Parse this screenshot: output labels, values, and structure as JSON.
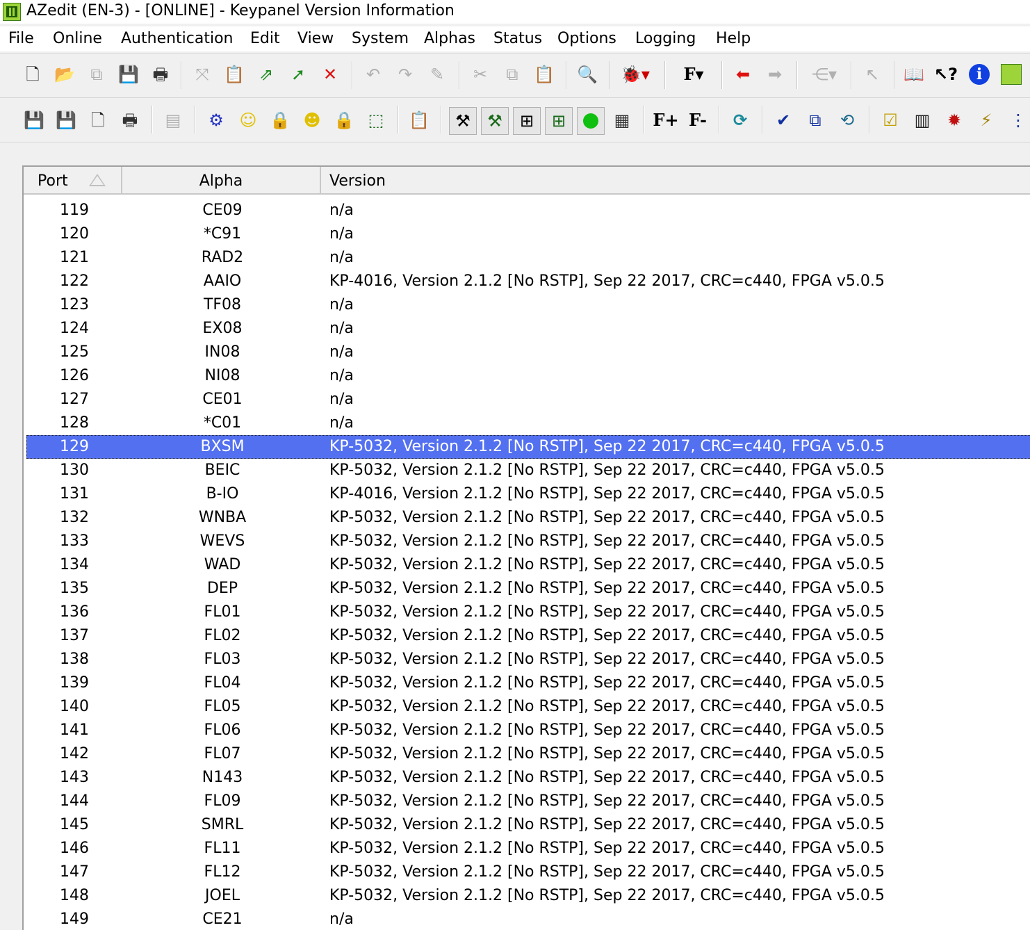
{
  "window": {
    "title": "AZedit (EN-3) - [ONLINE] - Keypanel Version Information"
  },
  "menu": [
    "File",
    "Online",
    "Authentication",
    "Edit",
    "View",
    "System",
    "Alphas",
    "Status",
    "Options",
    "Logging",
    "Help"
  ],
  "toolbar1_icons": [
    "new-document-icon",
    "open-folder-icon",
    "copy-disabled-icon",
    "save-icon",
    "print-icon",
    "connect-disabled-icon",
    "clipboard-icon",
    "export-icon",
    "green-arrow-icon",
    "red-x-icon",
    "undo-icon",
    "redo-icon",
    "eraser-icon",
    "cut-icon",
    "copy-icon",
    "paste-icon",
    "find-icon",
    "bug-dropdown-icon",
    "font-dropdown-icon",
    "back-arrow-icon",
    "forward-arrow-icon",
    "network-dropdown-icon",
    "pointer-disabled-icon",
    "book-icon",
    "help-pointer-icon",
    "info-icon",
    "keypanel-icon"
  ],
  "toolbar2_icons": [
    "save-green-icon",
    "save-red-icon",
    "print-preview-icon",
    "print-all-icon",
    "disabled-icon",
    "gear-icon",
    "smiley-icon",
    "lock-disabled-icon",
    "smiley-group-icon",
    "lock-icon",
    "panel-export-icon",
    "paste-disabled-icon",
    "tools-icon",
    "tools-add-icon",
    "tree-icon",
    "tree-add-icon",
    "green-dot-icon",
    "calculator-icon",
    "font-plus-icon",
    "font-minus-icon",
    "refresh-icon",
    "spellcheck-icon",
    "language-icon",
    "globe-refresh-icon",
    "checklist-icon",
    "device-icon",
    "chip-icon",
    "lightning-icon",
    "network-icon"
  ],
  "font_labels": {
    "f": "F",
    "f_plus": "F+",
    "f_minus": "F-"
  },
  "table": {
    "columns": {
      "port": "Port",
      "alpha": "Alpha",
      "version": "Version"
    },
    "selected_port": "129",
    "rows": [
      {
        "port": "119",
        "alpha": "CE09",
        "version": "n/a"
      },
      {
        "port": "120",
        "alpha": "*C91",
        "version": "n/a"
      },
      {
        "port": "121",
        "alpha": "RAD2",
        "version": "n/a"
      },
      {
        "port": "122",
        "alpha": "AAIO",
        "version": "KP-4016, Version 2.1.2 [No RSTP], Sep 22 2017, CRC=c440, FPGA v5.0.5"
      },
      {
        "port": "123",
        "alpha": "TF08",
        "version": "n/a"
      },
      {
        "port": "124",
        "alpha": "EX08",
        "version": "n/a"
      },
      {
        "port": "125",
        "alpha": "IN08",
        "version": "n/a"
      },
      {
        "port": "126",
        "alpha": "NI08",
        "version": "n/a"
      },
      {
        "port": "127",
        "alpha": "CE01",
        "version": "n/a"
      },
      {
        "port": "128",
        "alpha": "*C01",
        "version": "n/a"
      },
      {
        "port": "129",
        "alpha": "BXSM",
        "version": "KP-5032, Version 2.1.2 [No RSTP], Sep 22 2017, CRC=c440, FPGA v5.0.5"
      },
      {
        "port": "130",
        "alpha": "BEIC",
        "version": "KP-5032, Version 2.1.2 [No RSTP], Sep 22 2017, CRC=c440, FPGA v5.0.5"
      },
      {
        "port": "131",
        "alpha": "B-IO",
        "version": "KP-4016, Version 2.1.2 [No RSTP], Sep 22 2017, CRC=c440, FPGA v5.0.5"
      },
      {
        "port": "132",
        "alpha": "WNBA",
        "version": "KP-5032, Version 2.1.2 [No RSTP], Sep 22 2017, CRC=c440, FPGA v5.0.5"
      },
      {
        "port": "133",
        "alpha": "WEVS",
        "version": "KP-5032, Version 2.1.2 [No RSTP], Sep 22 2017, CRC=c440, FPGA v5.0.5"
      },
      {
        "port": "134",
        "alpha": "WAD",
        "version": "KP-5032, Version 2.1.2 [No RSTP], Sep 22 2017, CRC=c440, FPGA v5.0.5"
      },
      {
        "port": "135",
        "alpha": "DEP",
        "version": "KP-5032, Version 2.1.2 [No RSTP], Sep 22 2017, CRC=c440, FPGA v5.0.5"
      },
      {
        "port": "136",
        "alpha": "FL01",
        "version": "KP-5032, Version 2.1.2 [No RSTP], Sep 22 2017, CRC=c440, FPGA v5.0.5"
      },
      {
        "port": "137",
        "alpha": "FL02",
        "version": "KP-5032, Version 2.1.2 [No RSTP], Sep 22 2017, CRC=c440, FPGA v5.0.5"
      },
      {
        "port": "138",
        "alpha": "FL03",
        "version": "KP-5032, Version 2.1.2 [No RSTP], Sep 22 2017, CRC=c440, FPGA v5.0.5"
      },
      {
        "port": "139",
        "alpha": "FL04",
        "version": "KP-5032, Version 2.1.2 [No RSTP], Sep 22 2017, CRC=c440, FPGA v5.0.5"
      },
      {
        "port": "140",
        "alpha": "FL05",
        "version": "KP-5032, Version 2.1.2 [No RSTP], Sep 22 2017, CRC=c440, FPGA v5.0.5"
      },
      {
        "port": "141",
        "alpha": "FL06",
        "version": "KP-5032, Version 2.1.2 [No RSTP], Sep 22 2017, CRC=c440, FPGA v5.0.5"
      },
      {
        "port": "142",
        "alpha": "FL07",
        "version": "KP-5032, Version 2.1.2 [No RSTP], Sep 22 2017, CRC=c440, FPGA v5.0.5"
      },
      {
        "port": "143",
        "alpha": "N143",
        "version": "KP-5032, Version 2.1.2 [No RSTP], Sep 22 2017, CRC=c440, FPGA v5.0.5"
      },
      {
        "port": "144",
        "alpha": "FL09",
        "version": "KP-5032, Version 2.1.2 [No RSTP], Sep 22 2017, CRC=c440, FPGA v5.0.5"
      },
      {
        "port": "145",
        "alpha": "SMRL",
        "version": "KP-5032, Version 2.1.2 [No RSTP], Sep 22 2017, CRC=c440, FPGA v5.0.5"
      },
      {
        "port": "146",
        "alpha": "FL11",
        "version": "KP-5032, Version 2.1.2 [No RSTP], Sep 22 2017, CRC=c440, FPGA v5.0.5"
      },
      {
        "port": "147",
        "alpha": "FL12",
        "version": "KP-5032, Version 2.1.2 [No RSTP], Sep 22 2017, CRC=c440, FPGA v5.0.5"
      },
      {
        "port": "148",
        "alpha": "JOEL",
        "version": "KP-5032, Version 2.1.2 [No RSTP], Sep 22 2017, CRC=c440, FPGA v5.0.5"
      },
      {
        "port": "149",
        "alpha": "CE21",
        "version": "n/a"
      }
    ]
  },
  "colors": {
    "selection": "#5370f0",
    "window_bg": "#f0f0f0",
    "list_bg": "#ffffff"
  }
}
